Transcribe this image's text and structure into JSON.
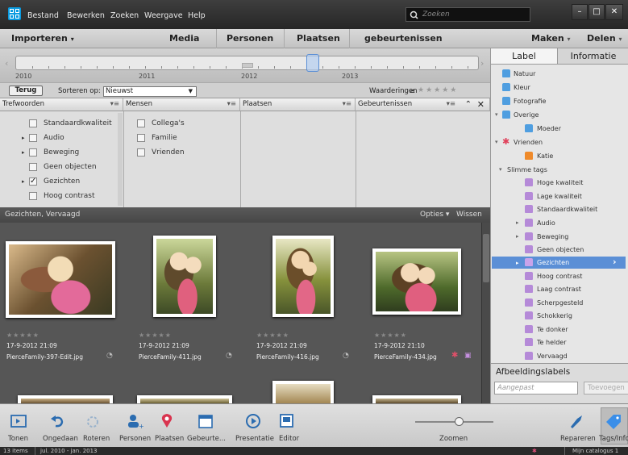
{
  "menu": {
    "items": [
      "Bestand",
      "Bewerken",
      "Zoeken",
      "Weergave",
      "Help"
    ],
    "search_placeholder": "Zoeken"
  },
  "modebar": {
    "import": "Importeren",
    "tabs": [
      "Media",
      "Personen",
      "Plaatsen",
      "gebeurtenissen"
    ],
    "create": "Maken",
    "share": "Delen"
  },
  "timeline": {
    "years": [
      "2010",
      "2011",
      "2012",
      "2013"
    ]
  },
  "sortbar": {
    "back": "Terug",
    "sort_label": "Sorteren op:",
    "sort_value": "Nieuwst",
    "ratings": "Waarderingen",
    "ratings_op": "≥"
  },
  "tagpanel": {
    "columns": [
      "Trefwoorden",
      "Mensen",
      "Plaatsen",
      "Gebeurtenissen"
    ],
    "keywords": [
      {
        "label": "Standaardkwaliteit",
        "checked": false,
        "expandable": false
      },
      {
        "label": "Audio",
        "checked": false,
        "expandable": true
      },
      {
        "label": "Beweging",
        "checked": false,
        "expandable": true
      },
      {
        "label": "Geen objecten",
        "checked": false,
        "expandable": false
      },
      {
        "label": "Gezichten",
        "checked": true,
        "expandable": true
      },
      {
        "label": "Hoog contrast",
        "checked": false,
        "expandable": false
      }
    ],
    "people": [
      "Collega's",
      "Familie",
      "Vrienden"
    ]
  },
  "filterbar": {
    "label": "Gezichten, Vervaagd",
    "options": "Opties",
    "clear": "Wissen"
  },
  "photos": [
    {
      "date": "17-9-2012 21:09",
      "file": "PierceFamily-397-Edit.jpg"
    },
    {
      "date": "17-9-2012 21:09",
      "file": "PierceFamily-411.jpg"
    },
    {
      "date": "17-9-2012 21:09",
      "file": "PierceFamily-416.jpg"
    },
    {
      "date": "17-9-2012 21:10",
      "file": "PierceFamily-434.jpg"
    }
  ],
  "rightpanel": {
    "tab_label": "Label",
    "tab_info": "Informatie",
    "tags": [
      "Natuur",
      "Kleur",
      "Fotografie",
      "Overige",
      "Moeder",
      "Vrienden",
      "Katie",
      "Slimme tags",
      "Hoge kwaliteit",
      "Lage kwaliteit",
      "Standaardkwaliteit",
      "Audio",
      "Beweging",
      "Geen objecten",
      "Gezichten",
      "Hoog contrast",
      "Laag contrast",
      "Scherpgesteld",
      "Schokkerig",
      "Te donker",
      "Te helder",
      "Vervaagd"
    ],
    "image_labels_title": "Afbeeldingslabels",
    "image_labels_placeholder": "Aangepast",
    "add_button": "Toevoegen"
  },
  "toolbar": {
    "items": [
      "Tonen",
      "Ongedaan",
      "Roteren",
      "Personen",
      "Plaatsen",
      "Gebeurte...",
      "Presentatie",
      "Editor",
      "Zoomen",
      "Repareren",
      "Tags/Info"
    ]
  },
  "status": {
    "items": "13 items",
    "range": "jul. 2010 - jan. 2013",
    "catalog": "Mijn catalogus 1"
  },
  "colors": {
    "accent_blue": "#3a78c9",
    "selection": "#5b8fd6"
  }
}
